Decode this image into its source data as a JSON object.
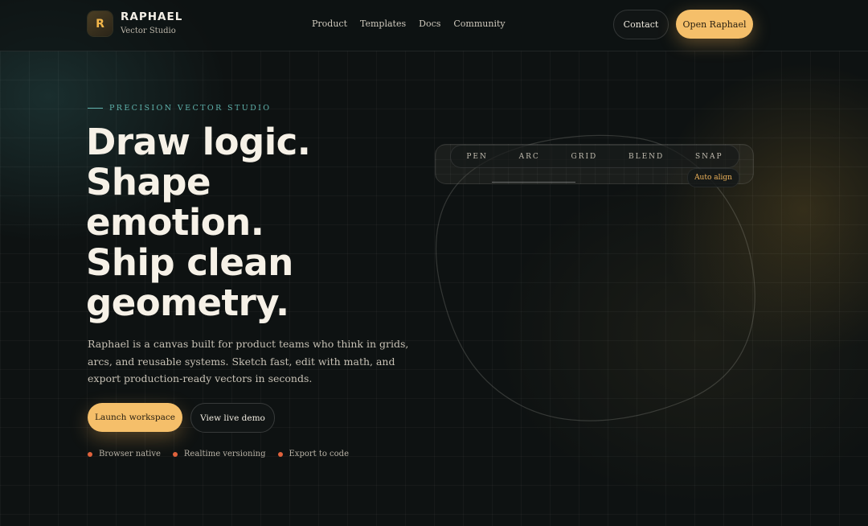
{
  "header": {
    "logo_letter": "R",
    "brand_name": "RAPHAEL",
    "brand_sub": "Vector Studio",
    "nav": [
      "Product",
      "Templates",
      "Docs",
      "Community"
    ],
    "contact_label": "Contact",
    "open_label": "Open Raphael"
  },
  "hero": {
    "eyebrow": "PRECISION VECTOR STUDIO",
    "headline_lines": [
      "Draw logic.",
      "Shape",
      "emotion.",
      "Ship clean",
      "geometry."
    ],
    "description": "Raphael is a canvas built for product teams who think in grids, arcs, and reusable systems. Sketch fast, edit with math, and export production-ready vectors in seconds.",
    "primary_cta": "Launch workspace",
    "secondary_cta": "View live demo",
    "features": [
      "Browser native",
      "Realtime versioning",
      "Export to code"
    ]
  },
  "canvas": {
    "tools": [
      "PEN",
      "ARC",
      "GRID",
      "BLEND",
      "SNAP"
    ],
    "auto_align": "Auto align"
  },
  "colors": {
    "background": "#0e1212",
    "accent": "#f5bf6a",
    "teal": "#5fb3ad",
    "dot": "#e0623c"
  }
}
